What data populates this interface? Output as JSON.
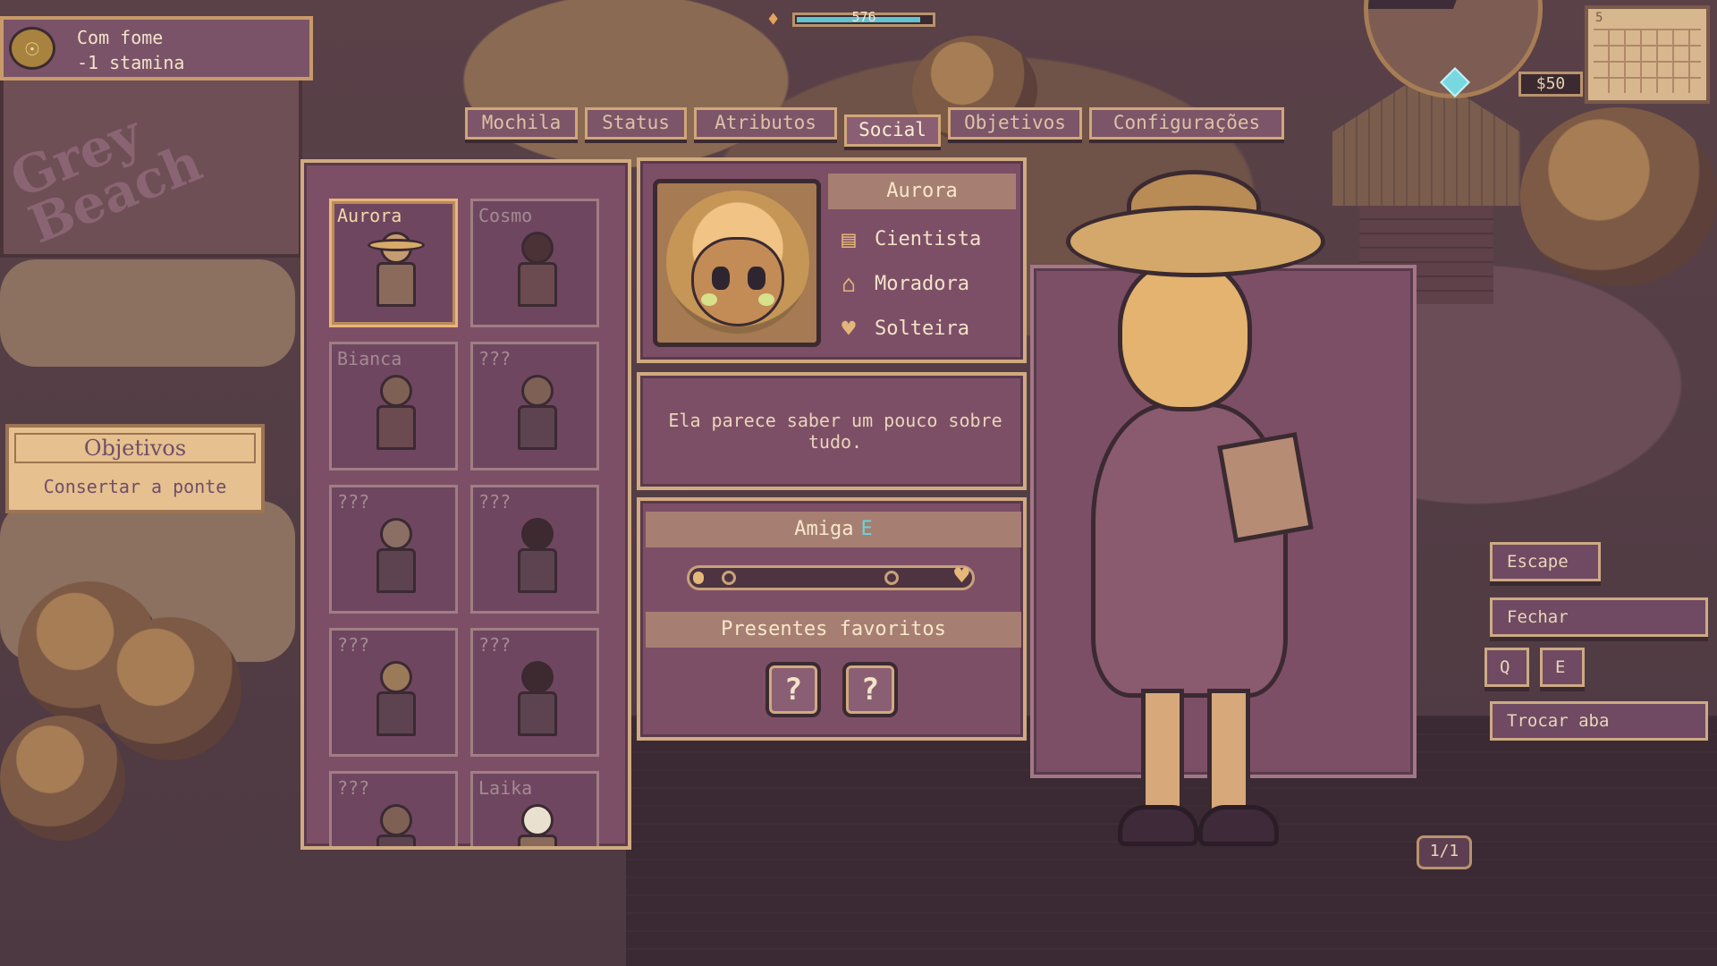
{
  "hud": {
    "status_title": "Com fome",
    "status_effect": "-1 stamina",
    "stamina_text": "576",
    "stamina_fraction": 0.92,
    "money": "$50",
    "calendar_day": "5"
  },
  "location_sign": "Grey Beach",
  "tabs": [
    {
      "label": "Mochila"
    },
    {
      "label": "Status"
    },
    {
      "label": "Atributos"
    },
    {
      "label": "Social"
    },
    {
      "label": "Objetivos"
    },
    {
      "label": "Configurações"
    }
  ],
  "active_tab": "Social",
  "objectives": {
    "title": "Objetivos",
    "item": "Consertar a ponte"
  },
  "characters": [
    {
      "name": "Aurora"
    },
    {
      "name": "Cosmo"
    },
    {
      "name": "Bianca"
    },
    {
      "name": "???"
    },
    {
      "name": "???"
    },
    {
      "name": "???"
    },
    {
      "name": "???"
    },
    {
      "name": "???"
    },
    {
      "name": "???"
    },
    {
      "name": "Laika"
    }
  ],
  "profile": {
    "name": "Aurora",
    "occupation": "Cientista",
    "residence": "Moradora",
    "relationship_status": "Solteira",
    "occupation_icon": "scroll-icon",
    "residence_icon": "house-icon",
    "status_icon": "heart-icon",
    "description": "Ela parece saber um pouco sobre tudo."
  },
  "relationship": {
    "label": "Amiga",
    "grade": "E",
    "progress": 0.04,
    "favorite_gifts_label": "Presentes favoritos",
    "gifts": [
      "?",
      "?"
    ]
  },
  "controls": {
    "escape": "Escape",
    "close": "Fechar",
    "key_q": "Q",
    "key_e": "E",
    "switch_tab": "Trocar aba",
    "pager": "1/1"
  },
  "colors": {
    "panel": "#7d4f67",
    "border": "#d0aa80",
    "accent_cyan": "#6ad4d8"
  }
}
